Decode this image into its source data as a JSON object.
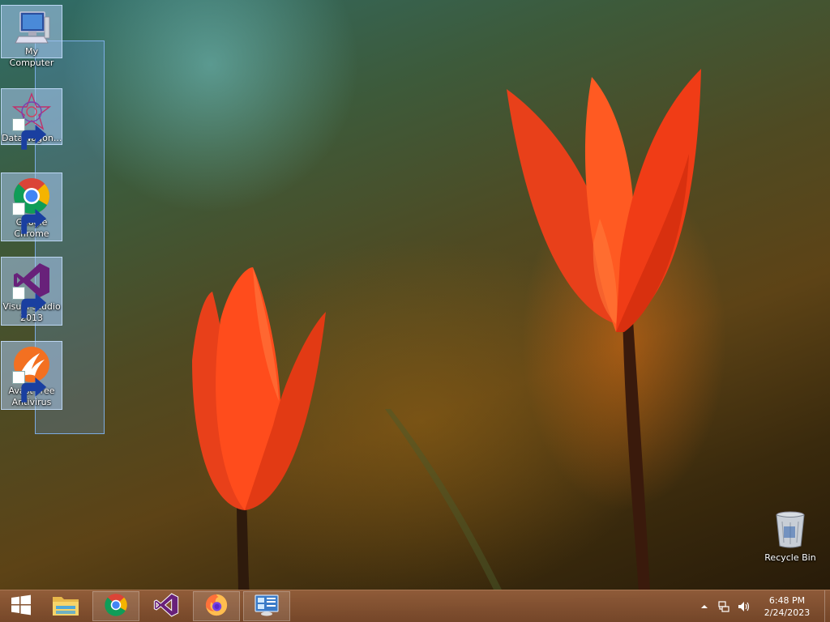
{
  "desktop": {
    "icons": [
      {
        "label": "My Computer",
        "icon": "computer-icon",
        "shortcut": false
      },
      {
        "label": "DataWagon...",
        "icon": "datawagon-icon",
        "shortcut": true
      },
      {
        "label": "Google Chrome",
        "icon": "chrome-icon",
        "shortcut": true
      },
      {
        "label": "Visual Studio 2013",
        "icon": "visual-studio-icon",
        "shortcut": true
      },
      {
        "label": "Avast Free Antivirus",
        "icon": "avast-icon",
        "shortcut": true
      }
    ],
    "recycle_bin": {
      "label": "Recycle Bin",
      "icon": "recycle-bin-icon"
    },
    "wallpaper": "red-tulips"
  },
  "taskbar": {
    "start": {
      "icon": "windows-logo-icon"
    },
    "pinned": [
      {
        "name": "File Explorer",
        "icon": "file-explorer-icon",
        "running": false
      },
      {
        "name": "Google Chrome",
        "icon": "chrome-icon",
        "running": true
      },
      {
        "name": "Visual Studio",
        "icon": "visual-studio-icon",
        "running": false
      },
      {
        "name": "Firefox",
        "icon": "firefox-icon",
        "running": true
      },
      {
        "name": "Control Panel",
        "icon": "control-panel-icon",
        "running": true
      }
    ],
    "tray": {
      "icons": [
        "show-hidden-icons-icon",
        "network-icon",
        "volume-icon"
      ],
      "time": "6:48 PM",
      "date": "2/24/2023"
    }
  },
  "colors": {
    "taskbar": "#8a5634",
    "tulip": "#ff4a1a",
    "selection": "#6aa6e6"
  }
}
